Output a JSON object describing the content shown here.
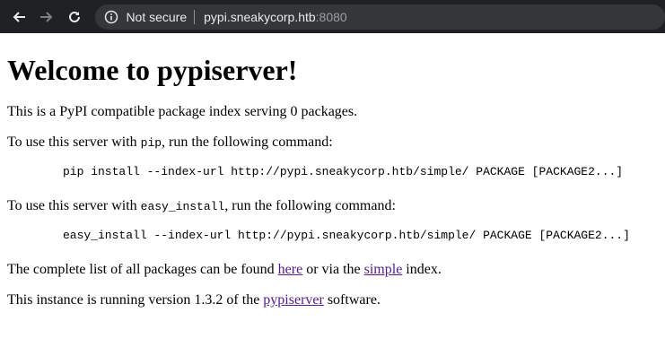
{
  "browser": {
    "security_label": "Not secure",
    "url_host": "pypi.sneakycorp.htb",
    "url_port": ":8080"
  },
  "page": {
    "title": "Welcome to pypiserver!",
    "intro": "This is a PyPI compatible package index serving 0 packages.",
    "pip_prefix": "To use this server with ",
    "pip_code": "pip",
    "pip_suffix": ", run the following command:",
    "pip_command": "pip install --index-url http://pypi.sneakycorp.htb/simple/ PACKAGE [PACKAGE2...]",
    "easy_prefix": "To use this server with ",
    "easy_code": "easy_install",
    "easy_suffix": ", run the following command:",
    "easy_command": "easy_install --index-url http://pypi.sneakycorp.htb/simple/ PACKAGE [PACKAGE2...]",
    "list_prefix": "The complete list of all packages can be found ",
    "here_link": "here",
    "list_middle": " or via the ",
    "simple_link": "simple",
    "list_suffix": " index.",
    "version_prefix": "This instance is running version 1.3.2 of the ",
    "pypiserver_link": "pypiserver",
    "version_suffix": " software."
  }
}
